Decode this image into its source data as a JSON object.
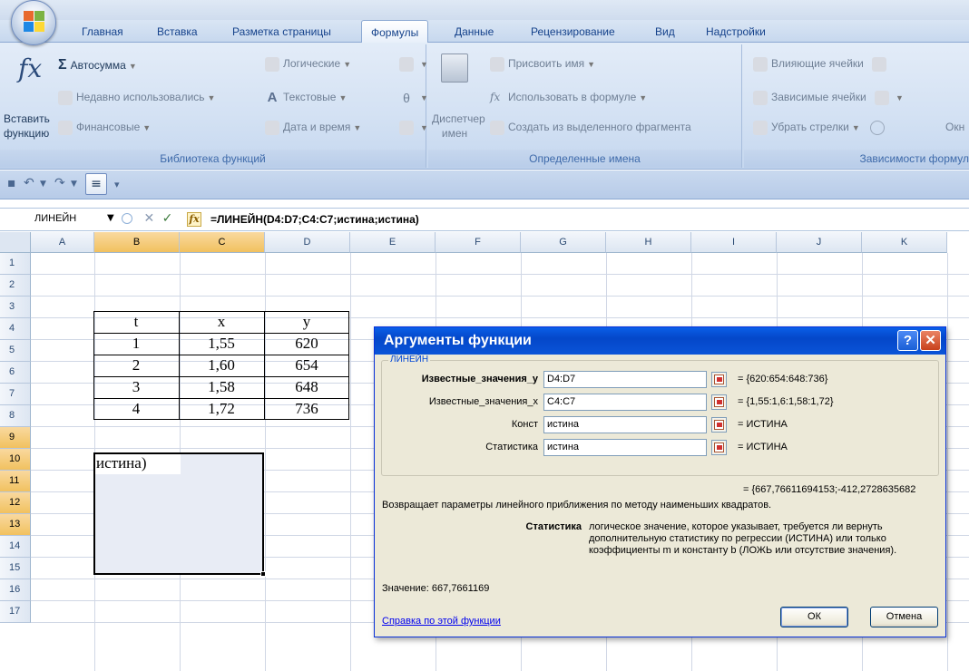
{
  "tabs": [
    "Главная",
    "Вставка",
    "Разметка страницы",
    "Формулы",
    "Данные",
    "Рецензирование",
    "Вид",
    "Надстройки"
  ],
  "ribbon": {
    "insert_function": [
      "Вставить",
      "функцию"
    ],
    "autosum": "Автосумма",
    "recently_used": "Недавно использовались",
    "financial": "Финансовые",
    "logical": "Логические",
    "text": "Текстовые",
    "datetime": "Дата и время",
    "library_label": "Библиотека функций",
    "name_manager": [
      "Диспетчер",
      "имен"
    ],
    "assign_name": "Присвоить имя",
    "use_in_formula": "Использовать в формуле",
    "create_from_selection": "Создать из выделенного фрагмента",
    "names_label": "Определенные имена",
    "trace_precedents": "Влияющие ячейки",
    "trace_dependents": "Зависимые ячейки",
    "remove_arrows": "Убрать стрелки",
    "auditing_label": "Зависимости формул",
    "window_cut": "Окн"
  },
  "formula_bar": {
    "name_box": "ЛИНЕЙН",
    "formula": "=ЛИНЕЙН(D4:D7;C4:C7;истина;истина)",
    "fx": "fx"
  },
  "grid": {
    "columns": [
      "A",
      "B",
      "C",
      "D",
      "E",
      "F",
      "G",
      "H",
      "I",
      "J",
      "K"
    ],
    "rows": [
      "1",
      "2",
      "3",
      "4",
      "5",
      "6",
      "7",
      "8",
      "9",
      "10",
      "11",
      "12",
      "13",
      "14",
      "15",
      "16",
      "17"
    ],
    "table_header": [
      "t",
      "x",
      "y"
    ],
    "table_rows": [
      [
        "1",
        "1,55",
        "620"
      ],
      [
        "2",
        "1,60",
        "654"
      ],
      [
        "3",
        "1,58",
        "648"
      ],
      [
        "4",
        "1,72",
        "736"
      ]
    ],
    "cell_b9": "истина)"
  },
  "dialog": {
    "title": "Аргументы функции",
    "help_btn": "?",
    "close_btn": "✕",
    "function_name": "ЛИНЕЙН",
    "args": [
      {
        "label": "Известные_значения_y",
        "value": "D4:D7",
        "result": "=  {620:654:648:736}"
      },
      {
        "label": "Известные_значения_x",
        "value": "C4:C7",
        "result": "=  {1,55:1,6:1,58:1,72}"
      },
      {
        "label": "Конст",
        "value": "истина",
        "result": "=  ИСТИНА"
      },
      {
        "label": "Статистика",
        "value": "истина",
        "result": "=  ИСТИНА"
      }
    ],
    "result_line": "=  {667,76611694153;-412,2728635682",
    "description": "Возвращает параметры линейного приближения по методу наименьших квадратов.",
    "arg_name": "Статистика",
    "arg_description": "логическое значение, которое указывает, требуется ли вернуть дополнительную статистику по регрессии (ИСТИНА) или только коэффициенты m и константу b (ЛОЖЬ или отсутствие значения).",
    "value_line": "Значение:  667,7661169",
    "help_link": "Справка по этой функции",
    "ok": "ОК",
    "cancel": "Отмена"
  }
}
